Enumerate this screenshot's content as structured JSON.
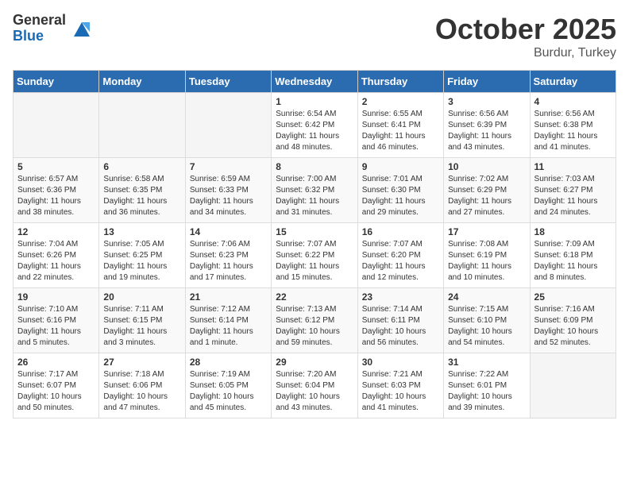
{
  "logo": {
    "general": "General",
    "blue": "Blue"
  },
  "header": {
    "month": "October 2025",
    "location": "Burdur, Turkey"
  },
  "weekdays": [
    "Sunday",
    "Monday",
    "Tuesday",
    "Wednesday",
    "Thursday",
    "Friday",
    "Saturday"
  ],
  "weeks": [
    [
      {
        "day": "",
        "info": ""
      },
      {
        "day": "",
        "info": ""
      },
      {
        "day": "",
        "info": ""
      },
      {
        "day": "1",
        "info": "Sunrise: 6:54 AM\nSunset: 6:42 PM\nDaylight: 11 hours\nand 48 minutes."
      },
      {
        "day": "2",
        "info": "Sunrise: 6:55 AM\nSunset: 6:41 PM\nDaylight: 11 hours\nand 46 minutes."
      },
      {
        "day": "3",
        "info": "Sunrise: 6:56 AM\nSunset: 6:39 PM\nDaylight: 11 hours\nand 43 minutes."
      },
      {
        "day": "4",
        "info": "Sunrise: 6:56 AM\nSunset: 6:38 PM\nDaylight: 11 hours\nand 41 minutes."
      }
    ],
    [
      {
        "day": "5",
        "info": "Sunrise: 6:57 AM\nSunset: 6:36 PM\nDaylight: 11 hours\nand 38 minutes."
      },
      {
        "day": "6",
        "info": "Sunrise: 6:58 AM\nSunset: 6:35 PM\nDaylight: 11 hours\nand 36 minutes."
      },
      {
        "day": "7",
        "info": "Sunrise: 6:59 AM\nSunset: 6:33 PM\nDaylight: 11 hours\nand 34 minutes."
      },
      {
        "day": "8",
        "info": "Sunrise: 7:00 AM\nSunset: 6:32 PM\nDaylight: 11 hours\nand 31 minutes."
      },
      {
        "day": "9",
        "info": "Sunrise: 7:01 AM\nSunset: 6:30 PM\nDaylight: 11 hours\nand 29 minutes."
      },
      {
        "day": "10",
        "info": "Sunrise: 7:02 AM\nSunset: 6:29 PM\nDaylight: 11 hours\nand 27 minutes."
      },
      {
        "day": "11",
        "info": "Sunrise: 7:03 AM\nSunset: 6:27 PM\nDaylight: 11 hours\nand 24 minutes."
      }
    ],
    [
      {
        "day": "12",
        "info": "Sunrise: 7:04 AM\nSunset: 6:26 PM\nDaylight: 11 hours\nand 22 minutes."
      },
      {
        "day": "13",
        "info": "Sunrise: 7:05 AM\nSunset: 6:25 PM\nDaylight: 11 hours\nand 19 minutes."
      },
      {
        "day": "14",
        "info": "Sunrise: 7:06 AM\nSunset: 6:23 PM\nDaylight: 11 hours\nand 17 minutes."
      },
      {
        "day": "15",
        "info": "Sunrise: 7:07 AM\nSunset: 6:22 PM\nDaylight: 11 hours\nand 15 minutes."
      },
      {
        "day": "16",
        "info": "Sunrise: 7:07 AM\nSunset: 6:20 PM\nDaylight: 11 hours\nand 12 minutes."
      },
      {
        "day": "17",
        "info": "Sunrise: 7:08 AM\nSunset: 6:19 PM\nDaylight: 11 hours\nand 10 minutes."
      },
      {
        "day": "18",
        "info": "Sunrise: 7:09 AM\nSunset: 6:18 PM\nDaylight: 11 hours\nand 8 minutes."
      }
    ],
    [
      {
        "day": "19",
        "info": "Sunrise: 7:10 AM\nSunset: 6:16 PM\nDaylight: 11 hours\nand 5 minutes."
      },
      {
        "day": "20",
        "info": "Sunrise: 7:11 AM\nSunset: 6:15 PM\nDaylight: 11 hours\nand 3 minutes."
      },
      {
        "day": "21",
        "info": "Sunrise: 7:12 AM\nSunset: 6:14 PM\nDaylight: 11 hours\nand 1 minute."
      },
      {
        "day": "22",
        "info": "Sunrise: 7:13 AM\nSunset: 6:12 PM\nDaylight: 10 hours\nand 59 minutes."
      },
      {
        "day": "23",
        "info": "Sunrise: 7:14 AM\nSunset: 6:11 PM\nDaylight: 10 hours\nand 56 minutes."
      },
      {
        "day": "24",
        "info": "Sunrise: 7:15 AM\nSunset: 6:10 PM\nDaylight: 10 hours\nand 54 minutes."
      },
      {
        "day": "25",
        "info": "Sunrise: 7:16 AM\nSunset: 6:09 PM\nDaylight: 10 hours\nand 52 minutes."
      }
    ],
    [
      {
        "day": "26",
        "info": "Sunrise: 7:17 AM\nSunset: 6:07 PM\nDaylight: 10 hours\nand 50 minutes."
      },
      {
        "day": "27",
        "info": "Sunrise: 7:18 AM\nSunset: 6:06 PM\nDaylight: 10 hours\nand 47 minutes."
      },
      {
        "day": "28",
        "info": "Sunrise: 7:19 AM\nSunset: 6:05 PM\nDaylight: 10 hours\nand 45 minutes."
      },
      {
        "day": "29",
        "info": "Sunrise: 7:20 AM\nSunset: 6:04 PM\nDaylight: 10 hours\nand 43 minutes."
      },
      {
        "day": "30",
        "info": "Sunrise: 7:21 AM\nSunset: 6:03 PM\nDaylight: 10 hours\nand 41 minutes."
      },
      {
        "day": "31",
        "info": "Sunrise: 7:22 AM\nSunset: 6:01 PM\nDaylight: 10 hours\nand 39 minutes."
      },
      {
        "day": "",
        "info": ""
      }
    ]
  ]
}
